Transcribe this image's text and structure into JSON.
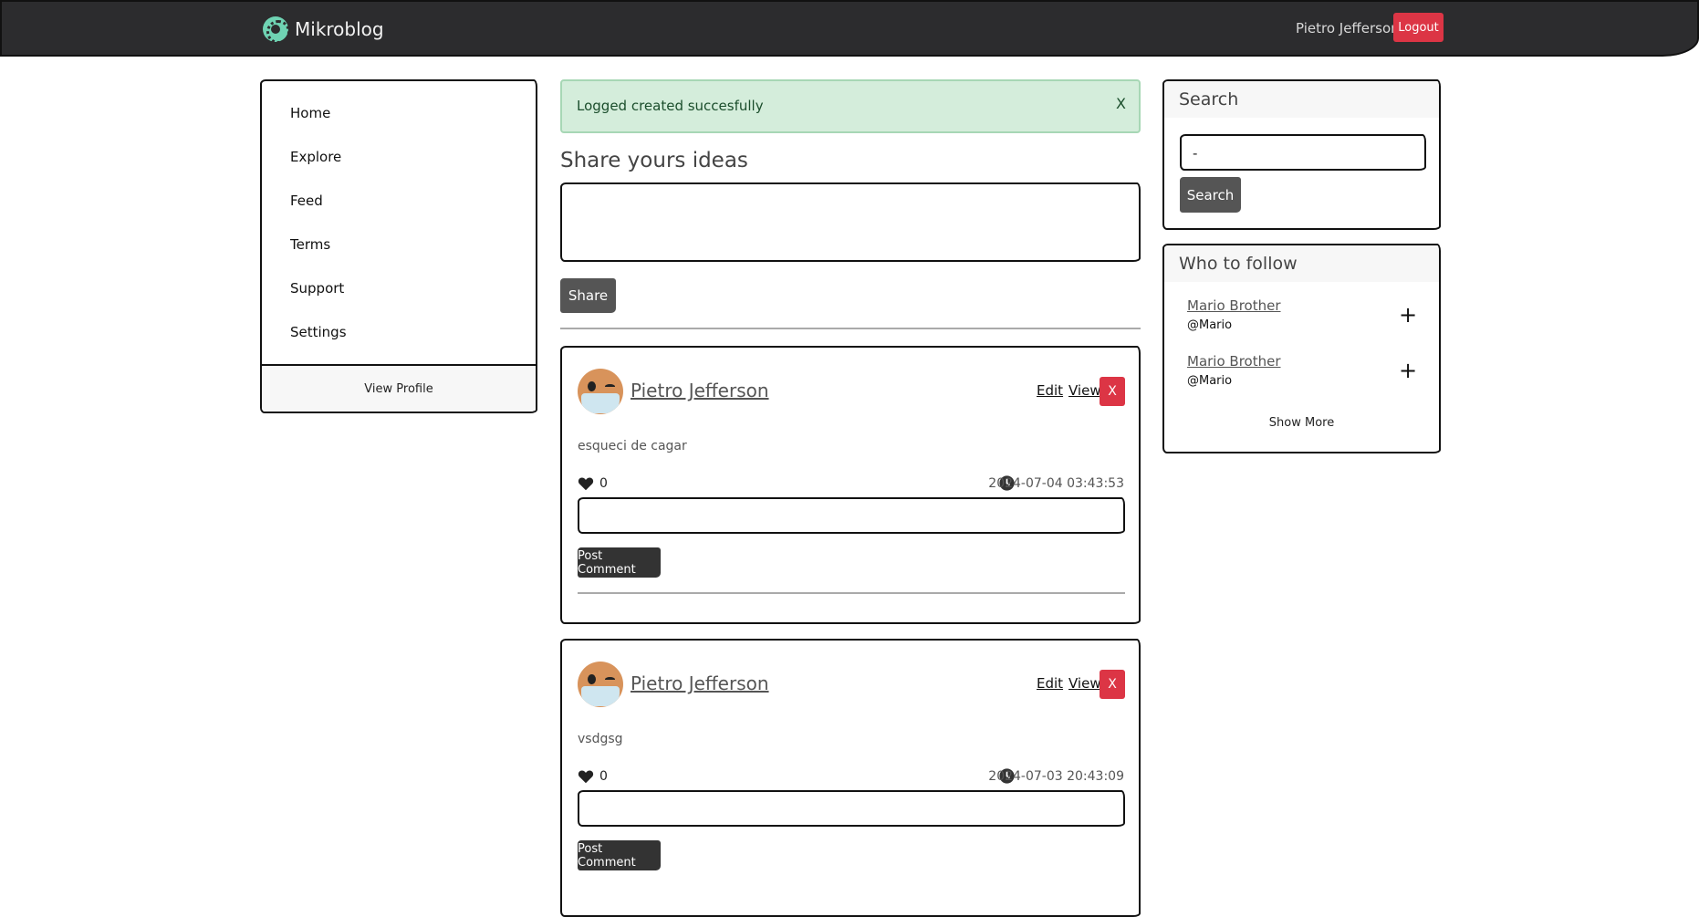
{
  "navbar": {
    "brand": "Mikroblog",
    "user_name": "Pietro Jefferson",
    "logout_label": "Logout",
    "brand_color": "#6fd3b3"
  },
  "sidebar": {
    "items": [
      {
        "label": "Home"
      },
      {
        "label": "Explore"
      },
      {
        "label": "Feed"
      },
      {
        "label": "Terms"
      },
      {
        "label": "Support"
      },
      {
        "label": "Settings"
      }
    ],
    "footer_label": "View Profile"
  },
  "alert": {
    "message": "Logged created succesfully",
    "close_label": "X"
  },
  "share": {
    "heading": "Share yours ideas",
    "value": "",
    "button_label": "Share"
  },
  "posts": [
    {
      "author": "Pietro Jefferson",
      "edit_label": "Edit",
      "view_label": "View",
      "delete_label": "X",
      "body": "esqueci de cagar",
      "likes": "0",
      "timestamp": "2024-07-04 03:43:53",
      "comment_value": "",
      "comment_button": "Post Comment"
    },
    {
      "author": "Pietro Jefferson",
      "edit_label": "Edit",
      "view_label": "View",
      "delete_label": "X",
      "body": "vsdgsg",
      "likes": "0",
      "timestamp": "2024-07-03 20:43:09",
      "comment_value": "",
      "comment_button": "Post Comment"
    }
  ],
  "search": {
    "title": "Search",
    "value": "-",
    "button_label": "Search"
  },
  "follow": {
    "title": "Who to follow",
    "users": [
      {
        "name": "Mario Brother",
        "handle": "@Mario",
        "add_icon": "+"
      },
      {
        "name": "Mario Brother",
        "handle": "@Mario",
        "add_icon": "+"
      }
    ],
    "show_more_label": "Show More"
  },
  "colors": {
    "navbar_bg": "#2c2c2e",
    "danger": "#dc3545",
    "alert_bg": "#d4eddb",
    "button_dark": "#555555"
  }
}
